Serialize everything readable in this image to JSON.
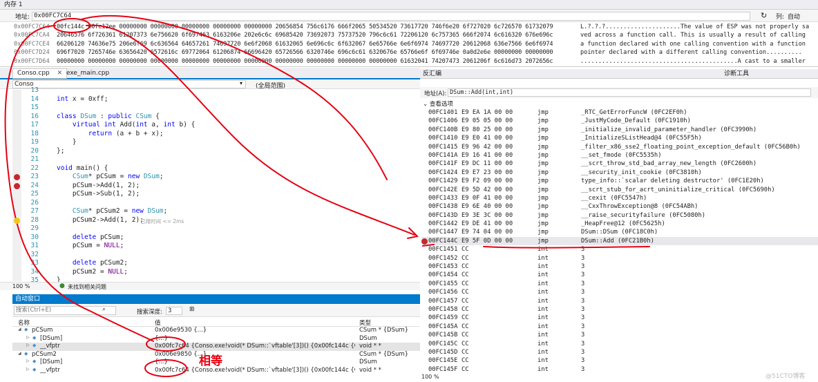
{
  "memory": {
    "title": "内存 1",
    "address_label": "地址:",
    "address_value": "0x00FC7C64",
    "col_label": "列:",
    "col_value": "自动",
    "rows": [
      {
        "addr": "0x00FC7C64",
        "hex": "00fc144c 00fc12ee 00000000 00000000 00000000 00000000 00000000 20656854 756c6176 666f2065 50534520 73617720 746f6e20 6f727020 6c726570 61732079",
        "ascii": "L.?.?.?.....................The value of ESP was not properly sa"
      },
      {
        "addr": "0x00FC7CA4",
        "hex": "20646576 6f726361 61207373 6e756620 6f697463 6163206e 202e6c6c 69685420 73692073 75737520 796c6c61 72206120 6c757365 666f2074 6c616320 676e696c",
        "ascii": "ved across a function call.  This is usually a result of calling"
      },
      {
        "addr": "0x00FC7CE4",
        "hex": "66206120 74636e75 206e6f69 6c636564 64657261 74697720 6e6f2068 61632065 6e696c6c 6f632067 6e65766e 6e6f6974 74697720 20612068 636e7566 6e6f6974",
        "ascii": " a function declared with one calling convention with a function"
      },
      {
        "addr": "0x00FC7D24",
        "hex": "696f7020 7265746e 63656420 6572616c 69772064 61206874 66696420 65726566 6320746e 696c6c61 6320676e 65766e6f 6f69746e 0a0d2e6e 00000000 00000000",
        "ascii": " pointer declared with a different calling convention.........."
      },
      {
        "addr": "0x00FC7D64",
        "hex": "00000000 00000000 00000000 00000000 00000000 00000000 00000000 00000000 00000000 00000000 00000000 61632041 74207473 2061206f 6c616d73 2072656c",
        "ascii": "............................................A cast to a smaller"
      }
    ]
  },
  "editor": {
    "tabs": [
      "Conso.cpp",
      "exe_main.cpp"
    ],
    "scope_left": "Conso",
    "scope_right": "(全局范围)",
    "zoom": "100 %",
    "status": "未找到相关问题",
    "time_hint": "已用时间 <= 2ms",
    "lines": [
      {
        "n": "13",
        "t": ""
      },
      {
        "n": "14",
        "t": "int x = 0xff;"
      },
      {
        "n": "15",
        "t": ""
      },
      {
        "n": "16",
        "t": "class DSum : public CSum {"
      },
      {
        "n": "17",
        "t": "    virtual int Add(int a, int b) {"
      },
      {
        "n": "18",
        "t": "        return (a + b + x);"
      },
      {
        "n": "19",
        "t": "    }"
      },
      {
        "n": "20",
        "t": "};"
      },
      {
        "n": "21",
        "t": ""
      },
      {
        "n": "22",
        "t": "void main() {"
      },
      {
        "n": "23",
        "t": "    CSum* pCSum = new DSum;"
      },
      {
        "n": "24",
        "t": "    pCSum->Add(1, 2);"
      },
      {
        "n": "25",
        "t": "    pCSum->Sub(1, 2);"
      },
      {
        "n": "26",
        "t": ""
      },
      {
        "n": "27",
        "t": "    CSum* pCSum2 = new DSum;"
      },
      {
        "n": "28",
        "t": "    pCSum2->Add(1, 2);"
      },
      {
        "n": "29",
        "t": ""
      },
      {
        "n": "30",
        "t": "    delete pCSum;"
      },
      {
        "n": "31",
        "t": "    pCSum = NULL;"
      },
      {
        "n": "32",
        "t": ""
      },
      {
        "n": "33",
        "t": "    delete pCSum2;"
      },
      {
        "n": "34",
        "t": "    pCSum2 = NULL;"
      },
      {
        "n": "35",
        "t": "}"
      }
    ]
  },
  "autos": {
    "title": "自动窗口",
    "search_placeholder": "搜索(Ctrl+E)",
    "depth_label": "搜索深度:",
    "depth_value": "3",
    "col_name": "名称",
    "col_value": "值",
    "col_type": "类型",
    "rows": [
      {
        "name": "pCSum",
        "value": "0x006e9530 {...}",
        "type": "CSum * {DSum}",
        "indent": 0
      },
      {
        "name": "[DSum]",
        "value": "{...}",
        "type": "DSum",
        "indent": 1
      },
      {
        "name": "__vfptr",
        "value": "0x00fc7c64 {Conso.exe!void(* DSum::`vftable'[3])() {0x00fc144c {Conso.exe!DSum:...",
        "type": "void * *",
        "indent": 1
      },
      {
        "name": "pCSum2",
        "value": "0x006e9850 {...}",
        "type": "CSum * {DSum}",
        "indent": 0
      },
      {
        "name": "[DSum]",
        "value": "{...}",
        "type": "DSum",
        "indent": 1
      },
      {
        "name": "__vfptr",
        "value": "0x00fc7c64 {Conso.exe!void(* DSum::`vftable'[3])() {0x00fc144c {Conso.exe!DSum:...",
        "type": "void * *",
        "indent": 1
      }
    ],
    "annotation": "相等"
  },
  "disasm": {
    "title": "反汇编",
    "diag_title": "诊断工具",
    "address_label": "地址(A):",
    "address_value": "DSum::Add(int,int)",
    "view_options": "查看选项",
    "zoom": "100 %",
    "rows": [
      {
        "addr": "00FC1401",
        "bytes": "E9 EA 1A 00 00",
        "op": "jmp",
        "arg": "_RTC_GetErrorFuncW (0FC2EF0h)"
      },
      {
        "addr": "00FC1406",
        "bytes": "E9 05 05 00 00",
        "op": "jmp",
        "arg": "_JustMyCode_Default (0FC1910h)"
      },
      {
        "addr": "00FC140B",
        "bytes": "E9 80 25 00 00",
        "op": "jmp",
        "arg": "_initialize_invalid_parameter_handler (0FC3990h)"
      },
      {
        "addr": "00FC1410",
        "bytes": "E9 E0 41 00 00",
        "op": "jmp",
        "arg": "_InitializeSListHead@4 (0FC55F5h)"
      },
      {
        "addr": "00FC1415",
        "bytes": "E9 96 42 00 00",
        "op": "jmp",
        "arg": "_filter_x86_sse2_floating_point_exception_default (0FC56B0h)"
      },
      {
        "addr": "00FC141A",
        "bytes": "E9 16 41 00 00",
        "op": "jmp",
        "arg": "__set_fmode (0FC5535h)"
      },
      {
        "addr": "00FC141F",
        "bytes": "E9 DC 11 00 00",
        "op": "jmp",
        "arg": "__scrt_throw_std_bad_array_new_length (0FC2600h)"
      },
      {
        "addr": "00FC1424",
        "bytes": "E9 E7 23 00 00",
        "op": "jmp",
        "arg": "__security_init_cookie (0FC3810h)"
      },
      {
        "addr": "00FC1429",
        "bytes": "E9 F2 09 00 00",
        "op": "jmp",
        "arg": "type_info::`scalar deleting destructor' (0FC1E20h)"
      },
      {
        "addr": "00FC142E",
        "bytes": "E9 5D 42 00 00",
        "op": "jmp",
        "arg": "__scrt_stub_for_acrt_uninitialize_critical (0FC5690h)"
      },
      {
        "addr": "00FC1433",
        "bytes": "E9 0F 41 00 00",
        "op": "jmp",
        "arg": "__cexit (0FC5547h)"
      },
      {
        "addr": "00FC1438",
        "bytes": "E9 6E 40 00 00",
        "op": "jmp",
        "arg": "__CxxThrowException@8 (0FC54ABh)"
      },
      {
        "addr": "00FC143D",
        "bytes": "E9 3E 3C 00 00",
        "op": "jmp",
        "arg": "__raise_securityfailure (0FC5080h)"
      },
      {
        "addr": "00FC1442",
        "bytes": "E9 DE 41 00 00",
        "op": "jmp",
        "arg": "_HeapFree@12 (0FC5625h)"
      },
      {
        "addr": "00FC1447",
        "bytes": "E9 74 04 00 00",
        "op": "jmp",
        "arg": "DSum::DSum (0FC18C0h)"
      },
      {
        "addr": "00FC144C",
        "bytes": "E9 5F 0D 00 00",
        "op": "jmp",
        "arg": "DSum::Add (0FC21B0h)"
      },
      {
        "addr": "00FC1451",
        "bytes": "CC",
        "op": "int",
        "arg": "3"
      },
      {
        "addr": "00FC1452",
        "bytes": "CC",
        "op": "int",
        "arg": "3"
      },
      {
        "addr": "00FC1453",
        "bytes": "CC",
        "op": "int",
        "arg": "3"
      },
      {
        "addr": "00FC1454",
        "bytes": "CC",
        "op": "int",
        "arg": "3"
      },
      {
        "addr": "00FC1455",
        "bytes": "CC",
        "op": "int",
        "arg": "3"
      },
      {
        "addr": "00FC1456",
        "bytes": "CC",
        "op": "int",
        "arg": "3"
      },
      {
        "addr": "00FC1457",
        "bytes": "CC",
        "op": "int",
        "arg": "3"
      },
      {
        "addr": "00FC1458",
        "bytes": "CC",
        "op": "int",
        "arg": "3"
      },
      {
        "addr": "00FC1459",
        "bytes": "CC",
        "op": "int",
        "arg": "3"
      },
      {
        "addr": "00FC145A",
        "bytes": "CC",
        "op": "int",
        "arg": "3"
      },
      {
        "addr": "00FC145B",
        "bytes": "CC",
        "op": "int",
        "arg": "3"
      },
      {
        "addr": "00FC145C",
        "bytes": "CC",
        "op": "int",
        "arg": "3"
      },
      {
        "addr": "00FC145D",
        "bytes": "CC",
        "op": "int",
        "arg": "3"
      },
      {
        "addr": "00FC145E",
        "bytes": "CC",
        "op": "int",
        "arg": "3"
      },
      {
        "addr": "00FC145F",
        "bytes": "CC",
        "op": "int",
        "arg": "3"
      }
    ]
  },
  "watermark": "@51CTO博客",
  "colors": {
    "annotation": "#e60012",
    "accent": "#007acc",
    "breakpoint": "#c5282f"
  }
}
